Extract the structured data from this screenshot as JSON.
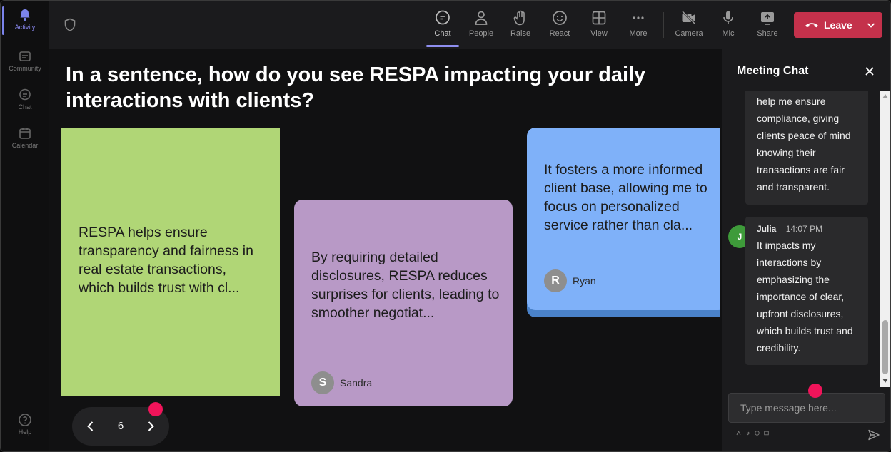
{
  "rail": {
    "items": [
      {
        "label": "Activity",
        "icon": "bell-icon",
        "active": true
      },
      {
        "label": "Community",
        "icon": "community-icon"
      },
      {
        "label": "Chat",
        "icon": "chat-icon"
      },
      {
        "label": "Calendar",
        "icon": "calendar-icon"
      }
    ],
    "help_label": "Help"
  },
  "toolbar": {
    "chat": "Chat",
    "people": "People",
    "raise": "Raise",
    "react": "React",
    "view": "View",
    "more": "More",
    "camera": "Camera",
    "mic": "Mic",
    "share": "Share",
    "leave": "Leave"
  },
  "stage": {
    "question": "In a sentence, how do you see RESPA impacting your daily interactions with clients?",
    "cards": [
      {
        "text": "RESPA helps ensure transparency and fairness in real estate transactions, which builds trust with cl...",
        "color": "#b0d676"
      },
      {
        "text": "By requiring detailed disclosures, RESPA reduces surprises for clients, leading to smoother negotiat...",
        "author": "Sandra",
        "initial": "S",
        "color": "#b899c6"
      },
      {
        "text": "It fosters a more informed client base, allowing me to focus on personalized service rather than cla...",
        "author": "Ryan",
        "initial": "R",
        "color": "#7fb1f9"
      }
    ],
    "page": "6"
  },
  "chat": {
    "title": "Meeting Chat",
    "messages": [
      {
        "text": "help me ensure compliance, giving clients peace of mind knowing their transactions are fair and transparent."
      },
      {
        "author": "Julia",
        "initial": "J",
        "time": "14:07 PM",
        "text": "It impacts my interactions by emphasizing the importance of clear, upfront disclosures, which builds trust and credibility."
      }
    ],
    "input_placeholder": "Type message here..."
  },
  "colors": {
    "accent": "#8f8ff0",
    "leave": "#c4314b",
    "marker": "#f0145a"
  }
}
